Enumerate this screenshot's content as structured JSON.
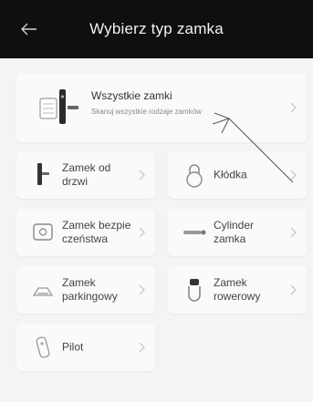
{
  "header": {
    "title": "Wybierz typ zamka",
    "back_icon": "arrow-left-icon"
  },
  "all_locks": {
    "title": "Wszystkie zamki",
    "subtitle": "Skanuj wszystkie rodzaje zamków"
  },
  "grid": [
    {
      "key": "door",
      "label_1": "Zamek od",
      "label_2": "drzwi",
      "icon": "door-lock-icon"
    },
    {
      "key": "padlock",
      "label_1": "Kłódka",
      "label_2": "",
      "icon": "padlock-icon"
    },
    {
      "key": "safe",
      "label_1": "Zamek bezpie",
      "label_2": "czeństwa",
      "icon": "safe-icon"
    },
    {
      "key": "cylinder",
      "label_1": "Cylinder",
      "label_2": "zamka",
      "icon": "cylinder-icon"
    },
    {
      "key": "parking",
      "label_1": "Zamek",
      "label_2": "parkingowy",
      "icon": "parking-lock-icon"
    },
    {
      "key": "bike",
      "label_1": "Zamek",
      "label_2": "rowerowy",
      "icon": "bike-lock-icon"
    },
    {
      "key": "remote",
      "label_1": "Pilot",
      "label_2": "",
      "icon": "remote-icon"
    }
  ],
  "colors": {
    "header_bg": "#0f0f0f",
    "page_bg": "#f4f4f4",
    "card_bg": "#fafafa"
  }
}
